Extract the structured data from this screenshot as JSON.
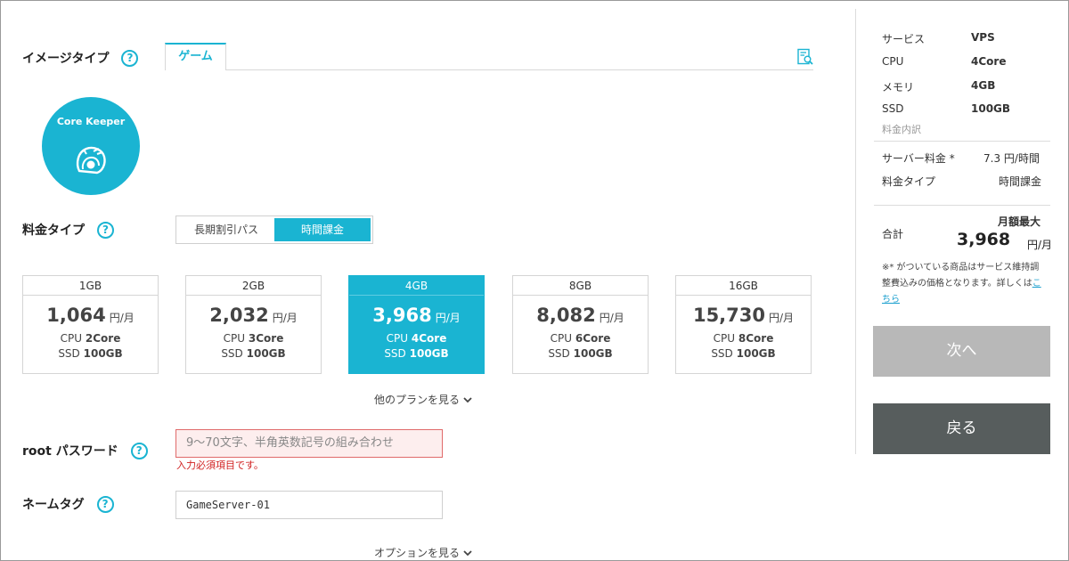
{
  "image_type": {
    "label": "イメージタイプ",
    "help_icon": "help-icon",
    "tab": "ゲーム",
    "search_icon": "document-search-icon",
    "game_name": "Core Keeper"
  },
  "pricing_type": {
    "label": "料金タイプ",
    "options": [
      "長期割引パス",
      "時間課金"
    ],
    "selected": "時間課金"
  },
  "plans": [
    {
      "memory": "1GB",
      "price": "1,064",
      "unit": "円/月",
      "cpu_prefix": "CPU",
      "cpu": "2Core",
      "ssd_prefix": "SSD",
      "ssd": "100GB"
    },
    {
      "memory": "2GB",
      "price": "2,032",
      "unit": "円/月",
      "cpu_prefix": "CPU",
      "cpu": "3Core",
      "ssd_prefix": "SSD",
      "ssd": "100GB"
    },
    {
      "memory": "4GB",
      "price": "3,968",
      "unit": "円/月",
      "cpu_prefix": "CPU",
      "cpu": "4Core",
      "ssd_prefix": "SSD",
      "ssd": "100GB"
    },
    {
      "memory": "8GB",
      "price": "8,082",
      "unit": "円/月",
      "cpu_prefix": "CPU",
      "cpu": "6Core",
      "ssd_prefix": "SSD",
      "ssd": "100GB"
    },
    {
      "memory": "16GB",
      "price": "15,730",
      "unit": "円/月",
      "cpu_prefix": "CPU",
      "cpu": "8Core",
      "ssd_prefix": "SSD",
      "ssd": "100GB"
    }
  ],
  "selected_plan": "4GB",
  "more_plans": "他のプランを見る",
  "root_password": {
    "label": "root パスワード",
    "placeholder": "9～70文字、半角英数記号の組み合わせ",
    "error": "入力必須項目です。"
  },
  "name_tag": {
    "label": "ネームタグ",
    "value": "GameServer-01"
  },
  "more_options": "オプションを見る",
  "summary": {
    "rows": [
      {
        "key": "サービス",
        "value": "VPS"
      },
      {
        "key": "CPU",
        "value": "4Core"
      },
      {
        "key": "メモリ",
        "value": "4GB"
      },
      {
        "key": "SSD",
        "value": "100GB"
      }
    ],
    "breakdown_label": "料金内訳",
    "server_fee_label": "サーバー料金 *",
    "server_fee_value": "7.3 円/時間",
    "fee_type_label": "料金タイプ",
    "fee_type_value": "時間課金",
    "total_label": "合計",
    "monthly_max": "月額最大",
    "total_value": "3,968",
    "total_unit": "円/月",
    "note_text": "※* がついている商品はサービス維持調整費込みの価格となります。詳しくは",
    "note_link": "こちら",
    "next_button": "次へ",
    "back_button": "戻る"
  },
  "colors": {
    "accent": "#1ab4d2",
    "error": "#d02020",
    "next_disabled": "#b8b8b8",
    "back": "#575d5d"
  }
}
